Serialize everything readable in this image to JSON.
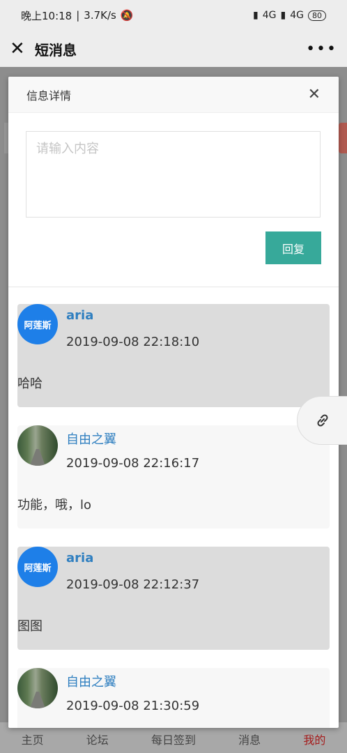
{
  "status": {
    "time": "晚上10:18",
    "speed": "3.7K/s",
    "net1": "4G",
    "net2": "4G",
    "battery": "80"
  },
  "appbar": {
    "title": "短消息"
  },
  "modal": {
    "title": "信息详情",
    "input_placeholder": "请输入内容",
    "reply_label": "回复"
  },
  "messages": [
    {
      "avatar_text": "阿莲斯",
      "name": "aria",
      "time": "2019-09-08 22:18:10",
      "body": "哈哈"
    },
    {
      "name": "自由之翼",
      "time": "2019-09-08 22:16:17",
      "body": "功能，哦，lo"
    },
    {
      "avatar_text": "阿莲斯",
      "name": "aria",
      "time": "2019-09-08 22:12:37",
      "body": "图图"
    },
    {
      "name": "自由之翼",
      "time": "2019-09-08 21:30:59",
      "body": ""
    }
  ],
  "tabs": [
    "主页",
    "论坛",
    "每日签到",
    "消息",
    "我的"
  ]
}
